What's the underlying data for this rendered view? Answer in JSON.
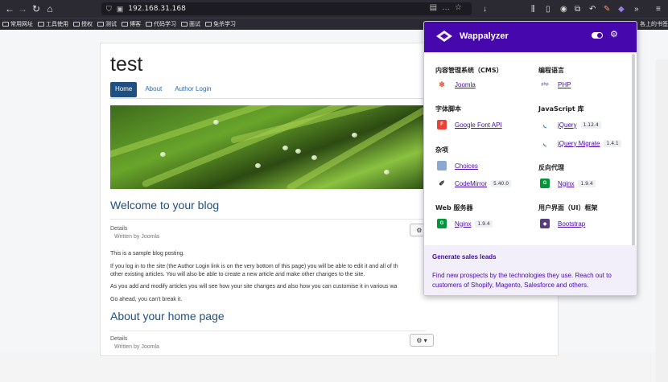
{
  "browser": {
    "url": "192.168.31.168",
    "bookmarks": [
      "常用网址",
      "工具使用",
      "授权",
      "测试",
      "博客",
      "代码学习",
      "面试",
      "免杀学习"
    ],
    "bookmarks_right": "各上的书签"
  },
  "site": {
    "title": "test",
    "nav": [
      "Home",
      "About",
      "Author Login"
    ]
  },
  "articles": [
    {
      "title": "Welcome to your blog",
      "details_label": "Details",
      "written_by": "Written by Joomla",
      "paragraphs": [
        "This is a sample blog posting.",
        "If you log in to the site (the Author Login link is on the very bottom of this page) you will be able to edit it and all of th",
        "other existing articles. You will also be able to create a new article and make other changes to the site.",
        "As you add and modify articles you will see how your site changes and also how you can customise it in various wa",
        "Go ahead, you can't break it."
      ]
    },
    {
      "title": "About your home page",
      "details_label": "Details",
      "written_by": "Written by Joomla"
    }
  ],
  "wappalyzer": {
    "name": "Wappalyzer",
    "categories": [
      {
        "title": "内容管理系统（CMS）",
        "items": [
          {
            "name": "Joomla",
            "icon": "joomla-icon",
            "color": "#f04f2f"
          }
        ]
      },
      {
        "title": "字体脚本",
        "items": [
          {
            "name": "Google Font API",
            "icon": "google-font-icon",
            "color": "#ea4335"
          }
        ]
      },
      {
        "title": "杂项",
        "items": [
          {
            "name": "Choices",
            "icon": "choices-icon",
            "color": "#8aa8d0"
          },
          {
            "name": "CodeMirror",
            "version": "5.40.0",
            "icon": "codemirror-icon",
            "color": "#333333"
          }
        ]
      },
      {
        "title": "Web 服务器",
        "items": [
          {
            "name": "Nginx",
            "version": "1.9.4",
            "icon": "nginx-icon",
            "color": "#009639"
          }
        ]
      },
      {
        "title": "编程语言",
        "items": [
          {
            "name": "PHP",
            "icon": "php-icon",
            "color": "#777bb3"
          }
        ]
      },
      {
        "title": "JavaScript 库",
        "items": [
          {
            "name": "jQuery",
            "version": "1.12.4",
            "icon": "jquery-icon",
            "color": "#0769ad"
          },
          {
            "name": "jQuery Migrate",
            "version": "1.4.1",
            "icon": "jquery-migrate-icon",
            "color": "#0769ad"
          }
        ]
      },
      {
        "title": "反向代理",
        "items": [
          {
            "name": "Nginx",
            "version": "1.9.4",
            "icon": "nginx-icon",
            "color": "#009639"
          }
        ]
      },
      {
        "title": "用户界面（UI）框架",
        "items": [
          {
            "name": "Bootstrap",
            "icon": "bootstrap-icon",
            "color": "#563d7c"
          }
        ]
      }
    ],
    "footer": {
      "title": "Generate sales leads",
      "text": "Find new prospects by the technologies they use. Reach out to customers of Shopify, Magento, Salesforce and others."
    }
  }
}
